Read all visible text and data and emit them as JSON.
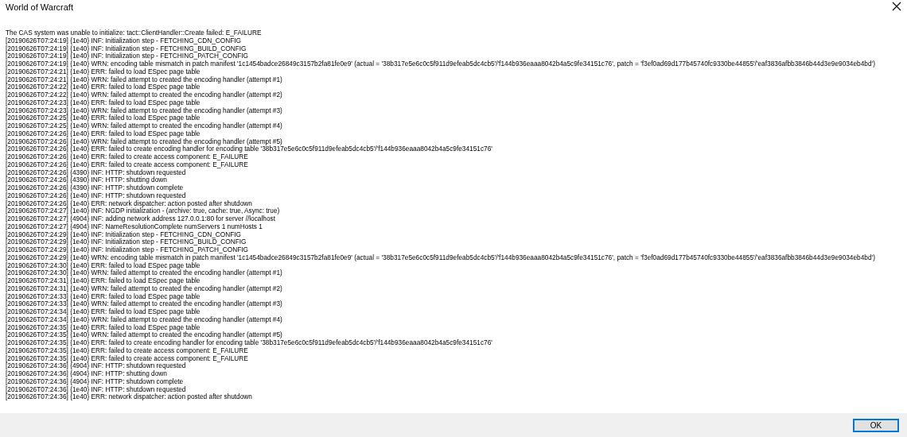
{
  "window": {
    "title": "World of Warcraft"
  },
  "message": "The CAS system was unable to initialize: tact::ClientHandler::Create failed: E_FAILURE",
  "log_lines": [
    "[20190626T07:24:19] {1e40} INF: Initialization step - FETCHING_CDN_CONFIG",
    "[20190626T07:24:19] {1e40} INF: Initialization step - FETCHING_BUILD_CONFIG",
    "[20190626T07:24:19] {1e40} INF: Initialization step - FETCHING_PATCH_CONFIG",
    "[20190626T07:24:19] {1e40} WRN: encoding table mismatch in patch manifest '1c1454badce26849c3157b2fa81fe0e9' (actual = '38b317e5e6c0c5f911d9efeab5dc4cb5'/'f144b936eaaa8042b4a5c9fe34151c76', patch = 'f3ef0ad69d177b45740fc9330be44855'/'eaf3836afbb3846b44d3e9e9034eb4bd')",
    "[20190626T07:24:21] {1e40} ERR: failed to load ESpec page table",
    "[20190626T07:24:21] {1e40} WRN: failed attempt to created the encoding handler (attempt #1)",
    "[20190626T07:24:22] {1e40} ERR: failed to load ESpec page table",
    "[20190626T07:24:22] {1e40} WRN: failed attempt to created the encoding handler (attempt #2)",
    "[20190626T07:24:23] {1e40} ERR: failed to load ESpec page table",
    "[20190626T07:24:23] {1e40} WRN: failed attempt to created the encoding handler (attempt #3)",
    "[20190626T07:24:25] {1e40} ERR: failed to load ESpec page table",
    "[20190626T07:24:25] {1e40} WRN: failed attempt to created the encoding handler (attempt #4)",
    "[20190626T07:24:26] {1e40} ERR: failed to load ESpec page table",
    "[20190626T07:24:26] {1e40} WRN: failed attempt to created the encoding handler (attempt #5)",
    "[20190626T07:24:26] {1e40} ERR: failed to create encoding handler for encoding table '38b317e5e6c0c5f911d9efeab5dc4cb5'/'f144b936eaaa8042b4a5c9fe34151c76'",
    "[20190626T07:24:26] {1e40} ERR: failed to create access component: E_FAILURE",
    "[20190626T07:24:26] {1e40} ERR: failed to create access component: E_FAILURE",
    "[20190626T07:24:26] {4390} INF: HTTP: shutdown requested",
    "[20190626T07:24:26] {4390} INF: HTTP: shutting down",
    "[20190626T07:24:26] {4390} INF: HTTP: shutdown complete",
    "[20190626T07:24:26] {1e40} INF: HTTP: shutdown requested",
    "[20190626T07:24:26] {1e40} ERR: network dispatcher: action posted after shutdown",
    "[20190626T07:24:27] {1e40} INF: NGDP initialization - (archive: true, cache: true, Async: true)",
    "[20190626T07:24:27] {4904} INF: adding network address 127.0.0.1:80 for server //localhost",
    "[20190626T07:24:27] {4904} INF: NameResolutionComplete numServers 1 numHosts 1",
    "[20190626T07:24:29] {1e40} INF: Initialization step - FETCHING_CDN_CONFIG",
    "[20190626T07:24:29] {1e40} INF: Initialization step - FETCHING_BUILD_CONFIG",
    "[20190626T07:24:29] {1e40} INF: Initialization step - FETCHING_PATCH_CONFIG",
    "[20190626T07:24:29] {1e40} WRN: encoding table mismatch in patch manifest '1c1454badce26849c3157b2fa81fe0e9' (actual = '38b317e5e6c0c5f911d9efeab5dc4cb5'/'f144b936eaaa8042b4a5c9fe34151c76', patch = 'f3ef0ad69d177b45740fc9330be44855'/'eaf3836afbb3846b44d3e9e9034eb4bd')",
    "[20190626T07:24:30] {1e40} ERR: failed to load ESpec page table",
    "[20190626T07:24:30] {1e40} WRN: failed attempt to created the encoding handler (attempt #1)",
    "[20190626T07:24:31] {1e40} ERR: failed to load ESpec page table",
    "[20190626T07:24:31] {1e40} WRN: failed attempt to created the encoding handler (attempt #2)",
    "[20190626T07:24:33] {1e40} ERR: failed to load ESpec page table",
    "[20190626T07:24:33] {1e40} WRN: failed attempt to created the encoding handler (attempt #3)",
    "[20190626T07:24:34] {1e40} ERR: failed to load ESpec page table",
    "[20190626T07:24:34] {1e40} WRN: failed attempt to created the encoding handler (attempt #4)",
    "[20190626T07:24:35] {1e40} ERR: failed to load ESpec page table",
    "[20190626T07:24:35] {1e40} WRN: failed attempt to created the encoding handler (attempt #5)",
    "[20190626T07:24:35] {1e40} ERR: failed to create encoding handler for encoding table '38b317e5e6c0c5f911d9efeab5dc4cb5'/'f144b936eaaa8042b4a5c9fe34151c76'",
    "[20190626T07:24:35] {1e40} ERR: failed to create access component: E_FAILURE",
    "[20190626T07:24:35] {1e40} ERR: failed to create access component: E_FAILURE",
    "[20190626T07:24:36] {4904} INF: HTTP: shutdown requested",
    "[20190626T07:24:36] {4904} INF: HTTP: shutting down",
    "[20190626T07:24:36] {4904} INF: HTTP: shutdown complete",
    "[20190626T07:24:36] {1e40} INF: HTTP: shutdown requested",
    "[20190626T07:24:36] {1e40} ERR: network dispatcher: action posted after shutdown"
  ],
  "buttons": [
    "OK"
  ]
}
